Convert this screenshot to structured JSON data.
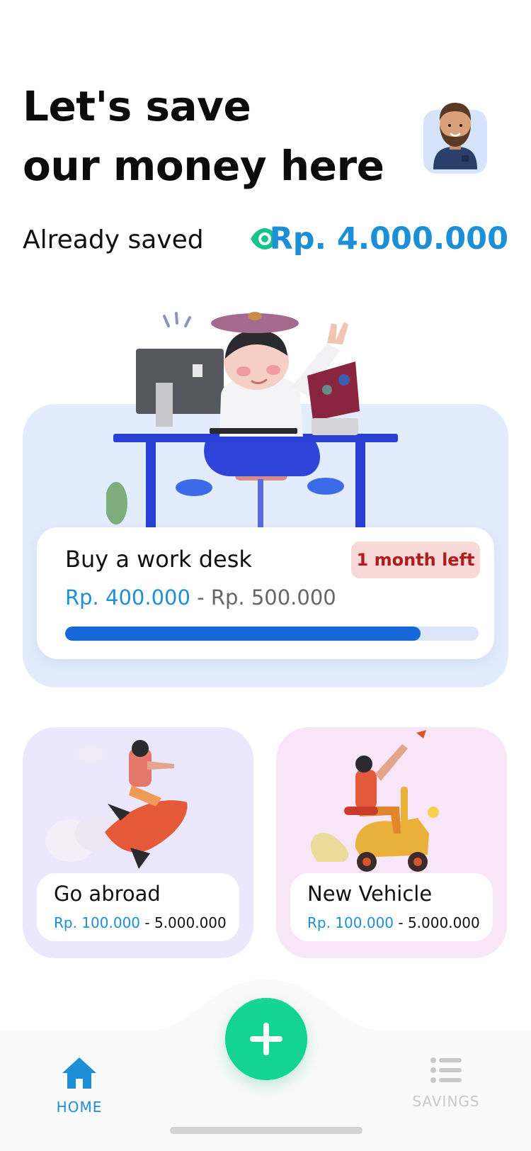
{
  "header": {
    "title_line1": "Let's save",
    "title_line2": "our money here"
  },
  "balance": {
    "label": "Already saved",
    "amount": "Rp. 4.000.000",
    "eye_color": "#14c48a",
    "amount_color": "#1c8fd6"
  },
  "featured_goal": {
    "title": "Buy a work desk",
    "deadline": "1 month left",
    "current": "Rp. 400.000",
    "separator": " - ",
    "target": "Rp. 500.000",
    "progress": 0.86
  },
  "goals": [
    {
      "title": "Go abroad",
      "current": "Rp. 100.000",
      "separator": " - ",
      "target": "5.000.000"
    },
    {
      "title": "New Vehicle",
      "current": "Rp. 100.000",
      "separator": " - ",
      "target": "5.000.000"
    }
  ],
  "nav": {
    "home_label": "HOME",
    "savings_label": "SAVINGS",
    "active": "home",
    "fab_icon": "plus-icon",
    "home_icon": "home-icon",
    "savings_icon": "list-icon",
    "accent": "#1c8fd6",
    "fab_color": "#14d494"
  }
}
